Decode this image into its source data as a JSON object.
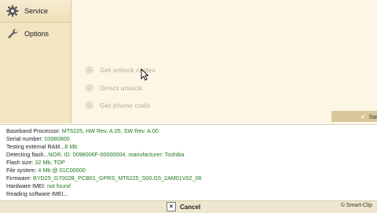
{
  "sidebar": {
    "items": [
      {
        "label": "Service",
        "icon": "gear-icon"
      },
      {
        "label": "Options",
        "icon": "wrench-icon"
      }
    ]
  },
  "actions": [
    {
      "label": "Get unlock codes"
    },
    {
      "label": "Direct unlock"
    },
    {
      "label": "Get phone code"
    }
  ],
  "save_label": "Sav",
  "log": [
    {
      "k": "Baseband Processor: ",
      "v": "MT6225, HW Rev. A.05, SW Rev. A.00"
    },
    {
      "k": "Serial number: ",
      "v": "03980800"
    },
    {
      "k": "Testing external RAM...",
      "v": "8 Mb"
    },
    {
      "k": "Detecting flash...",
      "v": "NOR, ID: 0098006F-00000004, manufacturer: Toshiba"
    },
    {
      "k": "Flash size: ",
      "v": "32 Mb, TOP"
    },
    {
      "k": "File system: ",
      "v": "4 Mb @ 01C00000"
    },
    {
      "k": "Firmware: ",
      "v": "BYD25_G7002B_PCB01_GPRS_MT6225_S00.G5_2AM01V02_06"
    },
    {
      "k": "Hardware IMEI: ",
      "v": "not found"
    },
    {
      "k": "Reading software IMEI...",
      "v": ""
    }
  ],
  "status": {
    "cancel_label": "Cancel",
    "copyright": "© Smart-Clip"
  },
  "colors": {
    "sidebar_bg": "#f3e5c2",
    "panel_bg": "#fdf6e6",
    "log_value": "#1c7a1c"
  }
}
